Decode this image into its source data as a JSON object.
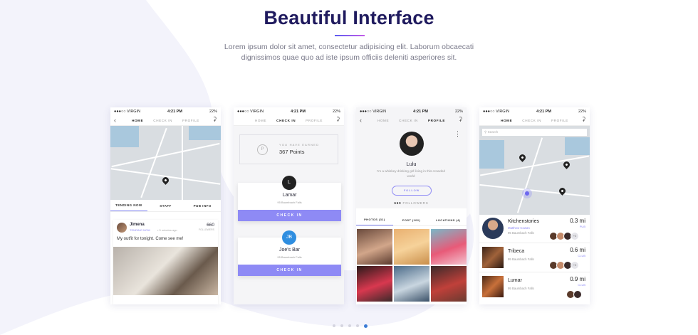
{
  "header": {
    "title": "Beautiful Interface",
    "description": "Lorem ipsum dolor sit amet, consectetur adipisicing elit. Laborum obcaecati dignissimos quae quo ad iste ipsum officiis deleniti asperiores sit."
  },
  "status_bar": {
    "carrier": "●●●○○ VIRGIN",
    "time": "4:21 PM",
    "battery": "22%"
  },
  "colors": {
    "accent": "#8e8af5",
    "title": "#1f1a5e",
    "dot_active": "#3a7bd5"
  },
  "nav": {
    "home": "HOME",
    "checkin": "CHECK IN",
    "profile": "PROFILE"
  },
  "screen1": {
    "tabs": [
      "TENDING NOW",
      "STAFF",
      "PUB INFO"
    ],
    "post": {
      "user": "Jimena",
      "tag": "TENDING NOW",
      "time": "• 5 minutes ago",
      "count": "660",
      "count_label": "FOLLOWERS",
      "text": "My outfit for tonight. Come see me!"
    }
  },
  "screen2": {
    "earned_label": "YOU HAVE EARNED",
    "points": "367 Points",
    "venues": [
      {
        "initial": "L",
        "name": "Lamar",
        "address": "95 Baumbach Falls",
        "button": "CHECK IN",
        "color": "#222222"
      },
      {
        "initial": "JB",
        "name": "Joe's Bar",
        "address": "95 Baumbach Falls",
        "button": "CHECK IN",
        "color": "#2f8ee0"
      }
    ]
  },
  "screen3": {
    "name": "Lulu",
    "bio": "I'm a whiskey drinking girl living in this crowded world",
    "follow": "FOLLOW",
    "followers": "660",
    "followers_label": "FOLLOWERS",
    "tabs": [
      "PHOTOS (31)",
      "POST (102)",
      "LOCATIONS (4)"
    ]
  },
  "screen4": {
    "search_placeholder": "Search",
    "places": [
      {
        "name": "Kitchenstories",
        "sub": "Matthew Cowan",
        "address": "95 Baumbach Falls",
        "distance": "0.3 mi",
        "type": "PUB",
        "more": "+3"
      },
      {
        "name": "Tribeca",
        "sub": "",
        "address": "95 Baumbach Falls",
        "distance": "0.6 mi",
        "type": "CLUB",
        "more": "+3"
      },
      {
        "name": "Lumar",
        "sub": "",
        "address": "95 Baumbach Falls",
        "distance": "0.9 mi",
        "type": "CLUB",
        "more": ""
      }
    ]
  },
  "carousel": {
    "pages": 5,
    "active": 5
  }
}
